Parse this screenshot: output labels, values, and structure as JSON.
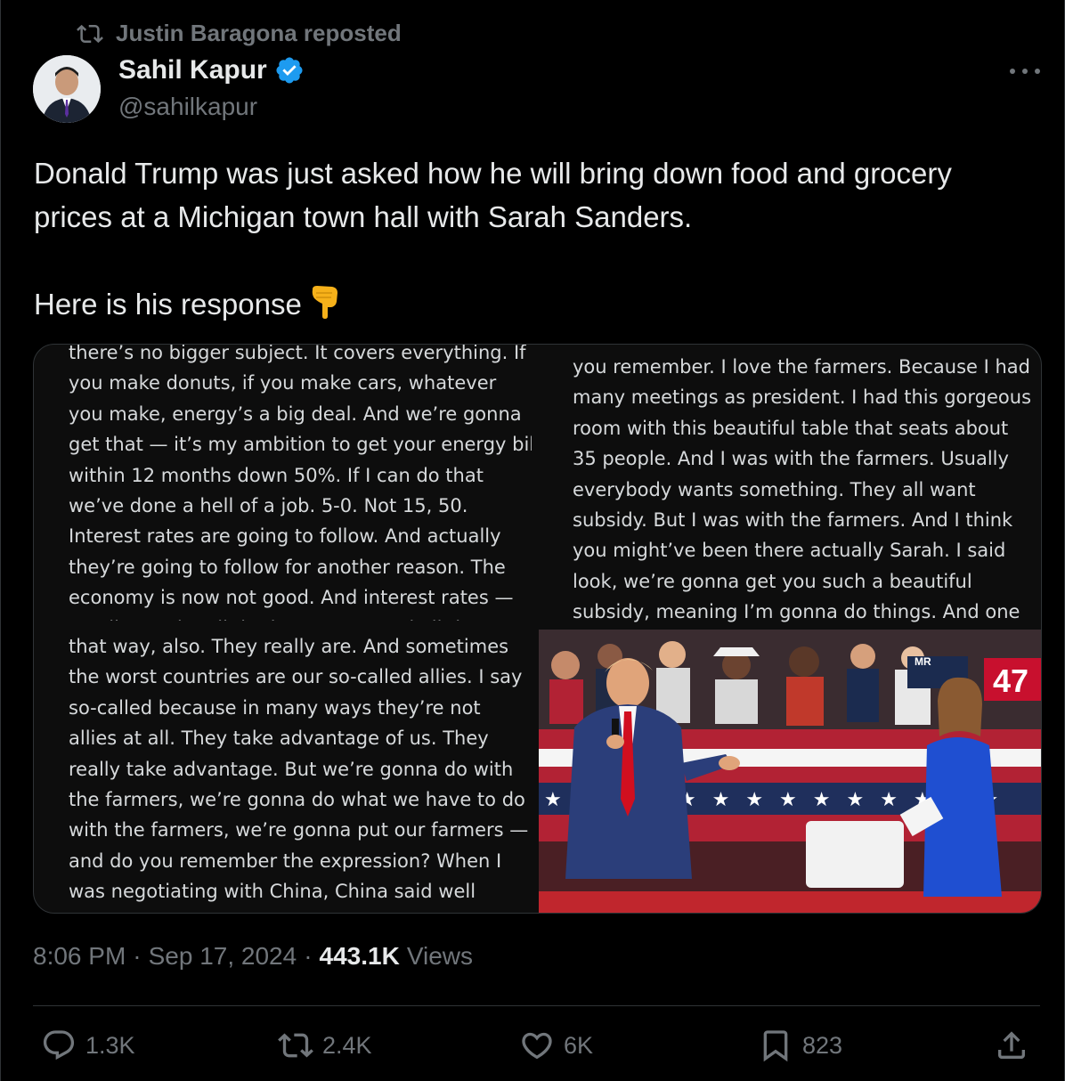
{
  "repost": {
    "label": "Justin Baragona reposted",
    "icon": "repost-icon"
  },
  "author": {
    "name": "Sahil Kapur",
    "handle": "@sahilkapur",
    "verified": true
  },
  "tweet": {
    "text": "Donald Trump was just asked how he will bring down food and grocery\nprices at a Michigan town hall with Sarah Sanders.\n\nHere is his response",
    "emoji": "👇"
  },
  "media": {
    "column_a": [
      "there’s no bigger subject. It covers everything. If",
      "you make donuts, if you make cars, whatever",
      "you make, energy’s a big deal. And we’re gonna",
      "get that — it’s my ambition to get your energy bill",
      "within 12 months down 50%. If I can do that",
      "we’ve done a hell of a job. 5-0. Not 15, 50.",
      "Interest rates are going to follow. And actually",
      "they’re going to follow for another reason. The",
      "economy is now not good. And interest rates —",
      "you’ll see, they’ll do the rate cut and all the"
    ],
    "column_b": [
      "that way, also. They really are. And sometimes",
      "the worst countries are our so-called allies. I say",
      "so-called because in many ways they’re not",
      "allies at all. They take advantage of us. They",
      "really take advantage. But we’re gonna do with",
      "the farmers, we’re gonna do what we have to do",
      "with the farmers, we’re gonna put our farmers —",
      "and do you remember the expression? When I",
      "was negotiating with China, China said well"
    ],
    "column_c": [
      "you remember. I love the farmers. Because I had",
      "many meetings as president. I had this gorgeous",
      "room with this beautiful table that seats about",
      "35 people. And I was with the farmers. Usually",
      "everybody wants something. They all want",
      "subsidy. But I was with the farmers. And I think",
      "you might’ve been there actually Sarah. I said",
      "look, we’re gonna get you such a beautiful",
      "subsidy, meaning I’m gonna do things. And one"
    ],
    "photo_sign": "47",
    "photo_banner": "MR"
  },
  "meta": {
    "time": "8:06 PM",
    "sep": "·",
    "date": "Sep 17, 2024",
    "views_count": "443.1K",
    "views_label": "Views"
  },
  "actions": {
    "replies": "1.3K",
    "reposts": "2.4K",
    "likes": "6K",
    "bookmarks": "823"
  },
  "colors": {
    "background": "#000000",
    "text": "#e7e9ea",
    "muted": "#71767b",
    "verified": "#1d9bf0",
    "border": "#2f3336"
  }
}
